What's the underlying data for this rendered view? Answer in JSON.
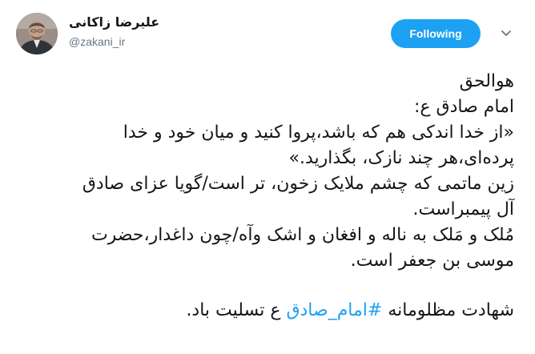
{
  "author": {
    "display_name": "علیرضا زاکانی",
    "handle": "@zakani_ir",
    "avatar_icon": "profile-photo"
  },
  "actions": {
    "follow_label": "Following",
    "menu_icon": "chevron-down-icon"
  },
  "colors": {
    "accent": "#1da1f2",
    "text": "#14171a",
    "secondary": "#657786"
  },
  "tweet": {
    "lines": [
      "هوالحق",
      "امام صادق ع:",
      "«از خدا اندکی هم که باشد،پروا کنید و میان خود و خدا",
      "پرده‌ای،هر چند نازک، بگذارید.»",
      "زین ماتمی که چشم ملایک زخون، تر است/گویا عزای صادق",
      "آل پیمبراست.",
      "مُلک و مَلک به ناله و افغان و اشک وآه/چون داغدار،حضرت",
      "موسی بن جعفر است."
    ],
    "last_line": {
      "before": "شهادت مظلومانه ",
      "hashtag": "#امام_صادق",
      "after": " ع تسلیت باد."
    }
  }
}
